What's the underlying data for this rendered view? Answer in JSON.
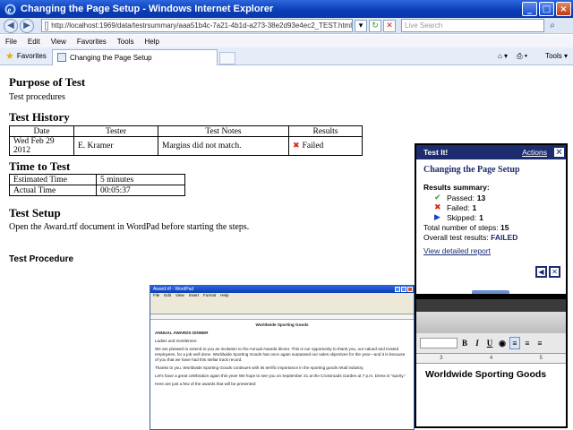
{
  "window": {
    "title": "Changing the Page Setup - Windows Internet Explorer",
    "buttons": [
      "_",
      "□",
      "×"
    ]
  },
  "address_bar": {
    "url": "http://localhost:1969/data/testrsummary/aaa51b4c-7a21-4b1d-a273-38e2d93e4ec2_TEST.html",
    "search_placeholder": "Live Search"
  },
  "menu": [
    "File",
    "Edit",
    "View",
    "Favorites",
    "Tools",
    "Help"
  ],
  "favorites_bar": {
    "favorites_label": "Favorites",
    "tab_label": "Changing the Page Setup",
    "tools_label": "Tools"
  },
  "page": {
    "purpose_heading": "Purpose of Test",
    "purpose_text": "Test procedures",
    "history_heading": "Test History",
    "history_columns": [
      "Date",
      "Tester",
      "Test Notes",
      "Results"
    ],
    "history_rows": [
      {
        "date": "Wed Feb 29 2012",
        "tester": "E. Kramer",
        "notes": "Margins did not match.",
        "result": "Failed"
      }
    ],
    "time_heading": "Time to Test",
    "time_rows": [
      {
        "label": "Estimated Time",
        "value": "5 minutes"
      },
      {
        "label": "Actual Time",
        "value": "00:05:37"
      }
    ],
    "setup_heading": "Test Setup",
    "setup_text": "Open the Award.rtf document in WordPad before starting the steps.",
    "procedure_heading": "Test Procedure"
  },
  "wordpad_thumb": {
    "title": "Award.rtf - WordPad",
    "menu": [
      "File",
      "Edit",
      "View",
      "Insert",
      "Format",
      "Help"
    ],
    "heading": "Worldwide Sporting Goods",
    "subheading": "ANNUAL AWARDS DINNER",
    "paragraphs": [
      "Ladies and Gentlemen:",
      "We are pleased to extend to you an invitation to the Annual Awards dinner. This is our opportunity to thank you, our valued and trusted employees, for a job well done. Worldwide Sporting Goods has once again surpassed our sales objectives for the year—and it is because of you that we have had this stellar track record.",
      "Thanks to you, Worldwide Sporting Goods continues with its terrific importance in the sporting goods retail industry.",
      "Let's have a great celebration again this year! We hope to see you on September 21 at the Crossroads Garden at 7 p.m. Dress is \"sporty.\"",
      "Here are just a few of the awards that will be presented:"
    ]
  },
  "test_panel": {
    "header": "Test It!",
    "actions_link": "Actions",
    "title": "Changing the Page Setup",
    "summary_label": "Results summary:",
    "passed_label": "Passed:",
    "passed_count": "13",
    "failed_label": "Failed:",
    "failed_count": "1",
    "skipped_label": "Skipped:",
    "skipped_count": "1",
    "total_label": "Total number of steps:",
    "total_count": "15",
    "overall_label": "Overall test results:",
    "overall_value": "FAILED",
    "detail_link": "View detailed report"
  },
  "zoom_panel": {
    "text": "Worldwide Sporting Goods",
    "ruler_marks": [
      "3",
      "4",
      "5"
    ]
  },
  "colors": {
    "panel_navy": "#1c2c6e",
    "fail_red": "#d42a12",
    "pass_green": "#3a9a2a"
  }
}
